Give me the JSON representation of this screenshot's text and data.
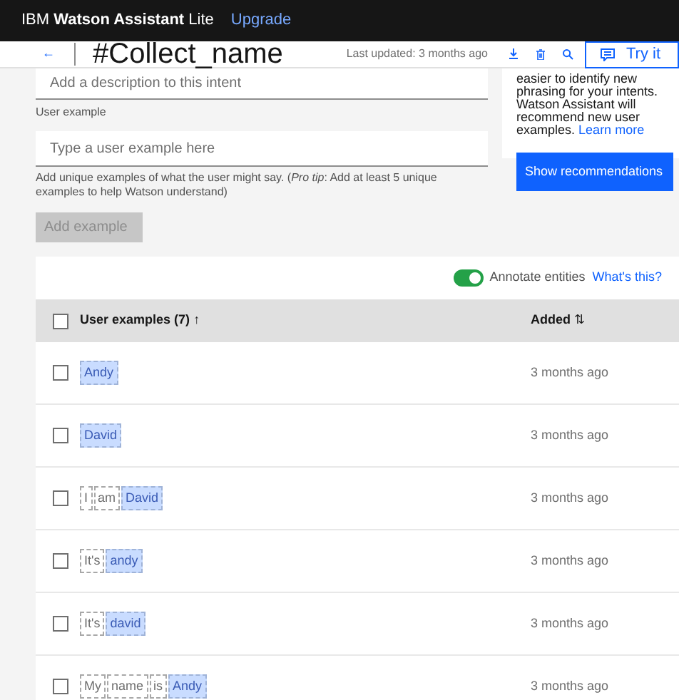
{
  "top_bar": {
    "product": "IBM",
    "product_bold": "Watson Assistant",
    "edition": "Lite",
    "upgrade_link": "Upgrade"
  },
  "header": {
    "back": "←",
    "title": "#Collect_name",
    "last_updated": "Last updated: 3 months ago",
    "try_it": "Try it"
  },
  "description_field": {
    "placeholder": "Add a description to this intent"
  },
  "user_example": {
    "label": "User example",
    "placeholder": "Type a user example here",
    "help": "Add unique examples of what the user might say. (*Pro tip*: Add at least 5 unique examples to help Watson understand)",
    "add_button": {
      "label": "Add example",
      "disabled": true
    }
  },
  "recommendations": {
    "text": "easier to identify new phrasing for your intents. Watson Assistant will recommend new user examples.",
    "link": "Learn more",
    "button": "Show recommendations"
  },
  "annotate": {
    "on": true,
    "label": "Annotate entities",
    "link": "What's this?"
  },
  "table": {
    "columns": [
      {
        "label": "User examples (7)",
        "sort": "↑"
      },
      {
        "label": "Added",
        "sort": "⇅"
      }
    ],
    "select_all": false,
    "rows": [
      {
        "selected": false,
        "tokens": [
          {
            "text": "Andy",
            "kind": "entity"
          }
        ],
        "added": "3 months ago"
      },
      {
        "selected": false,
        "tokens": [
          {
            "text": "David",
            "kind": "entity"
          }
        ],
        "added": "3 months ago"
      },
      {
        "selected": false,
        "tokens": [
          {
            "text": "I",
            "kind": "word"
          },
          {
            "text": "am",
            "kind": "word"
          },
          {
            "text": "David",
            "kind": "entity"
          }
        ],
        "added": "3 months ago"
      },
      {
        "selected": false,
        "tokens": [
          {
            "text": "It's",
            "kind": "word"
          },
          {
            "text": "andy",
            "kind": "entity"
          }
        ],
        "added": "3 months ago"
      },
      {
        "selected": false,
        "tokens": [
          {
            "text": "It's",
            "kind": "word"
          },
          {
            "text": "david",
            "kind": "entity"
          }
        ],
        "added": "3 months ago"
      },
      {
        "selected": false,
        "tokens": [
          {
            "text": "My",
            "kind": "word"
          },
          {
            "text": "name",
            "kind": "word"
          },
          {
            "text": "is",
            "kind": "word"
          },
          {
            "text": "Andy",
            "kind": "entity"
          }
        ],
        "added": "3 months ago"
      }
    ]
  }
}
